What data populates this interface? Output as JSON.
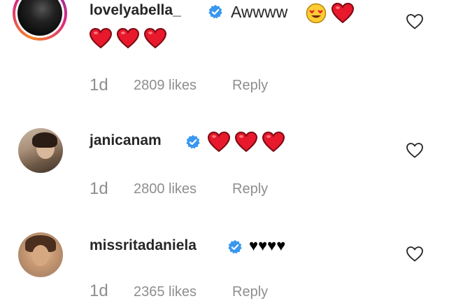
{
  "comments": [
    {
      "username": "lovelyabella_",
      "text": "Awwww",
      "time": "1d",
      "likes": "2809 likes",
      "reply": "Reply",
      "emoji": [
        "heart-eyes-emoji",
        "red-heart",
        "red-heart",
        "red-heart",
        "red-heart"
      ]
    },
    {
      "username": "janicanam",
      "text": "",
      "time": "1d",
      "likes": "2800 likes",
      "reply": "Reply",
      "emoji": [
        "red-heart",
        "red-heart",
        "red-heart"
      ]
    },
    {
      "username": "missritadaniela",
      "text": "♥♥♥♥",
      "time": "1d",
      "likes": "2365 likes",
      "reply": "Reply",
      "emoji": []
    }
  ],
  "colors": {
    "verified": "#3897f0",
    "heart_red": "#e8192c",
    "meta_gray": "#8e8e8e",
    "username": "#262626"
  },
  "icons": [
    "verified-badge-icon",
    "like-heart-outline-icon"
  ]
}
